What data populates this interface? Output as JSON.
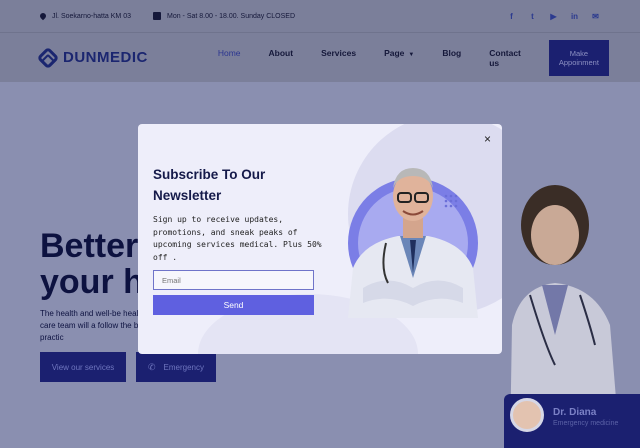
{
  "topbar": {
    "address": "Jl. Soekarno-hatta KM 03",
    "hours": "Mon - Sat 8.00 - 18.00. Sunday CLOSED",
    "socials": [
      "facebook-icon",
      "twitter-icon",
      "youtube-icon",
      "linkedin-icon",
      "email-icon"
    ]
  },
  "nav": {
    "logo": "DUNMEDIC",
    "items": [
      "Home",
      "About",
      "Services",
      "Page",
      "Blog",
      "Contact us"
    ],
    "cta": "Make Appoinment"
  },
  "hero": {
    "title_line1": "Better",
    "title_line2": "your h",
    "text": "The health and well-be health care team will a follow the best practic",
    "btn_services": "View our services",
    "btn_emergency": "Emergency",
    "doctor_name": "Dr. Diana",
    "doctor_role": "Emergency medicine"
  },
  "modal": {
    "close": "×",
    "title": "Subscribe To Our Newsletter",
    "text": "Sign up to receive updates, promotions, and sneak peaks of upcoming services medical. Plus 50% off .",
    "email_placeholder": "Email",
    "send_label": "Send"
  },
  "colors": {
    "brand_dark": "#1b2070",
    "send_button": "#5f60e0",
    "modal_bg": "#eeeefa"
  }
}
